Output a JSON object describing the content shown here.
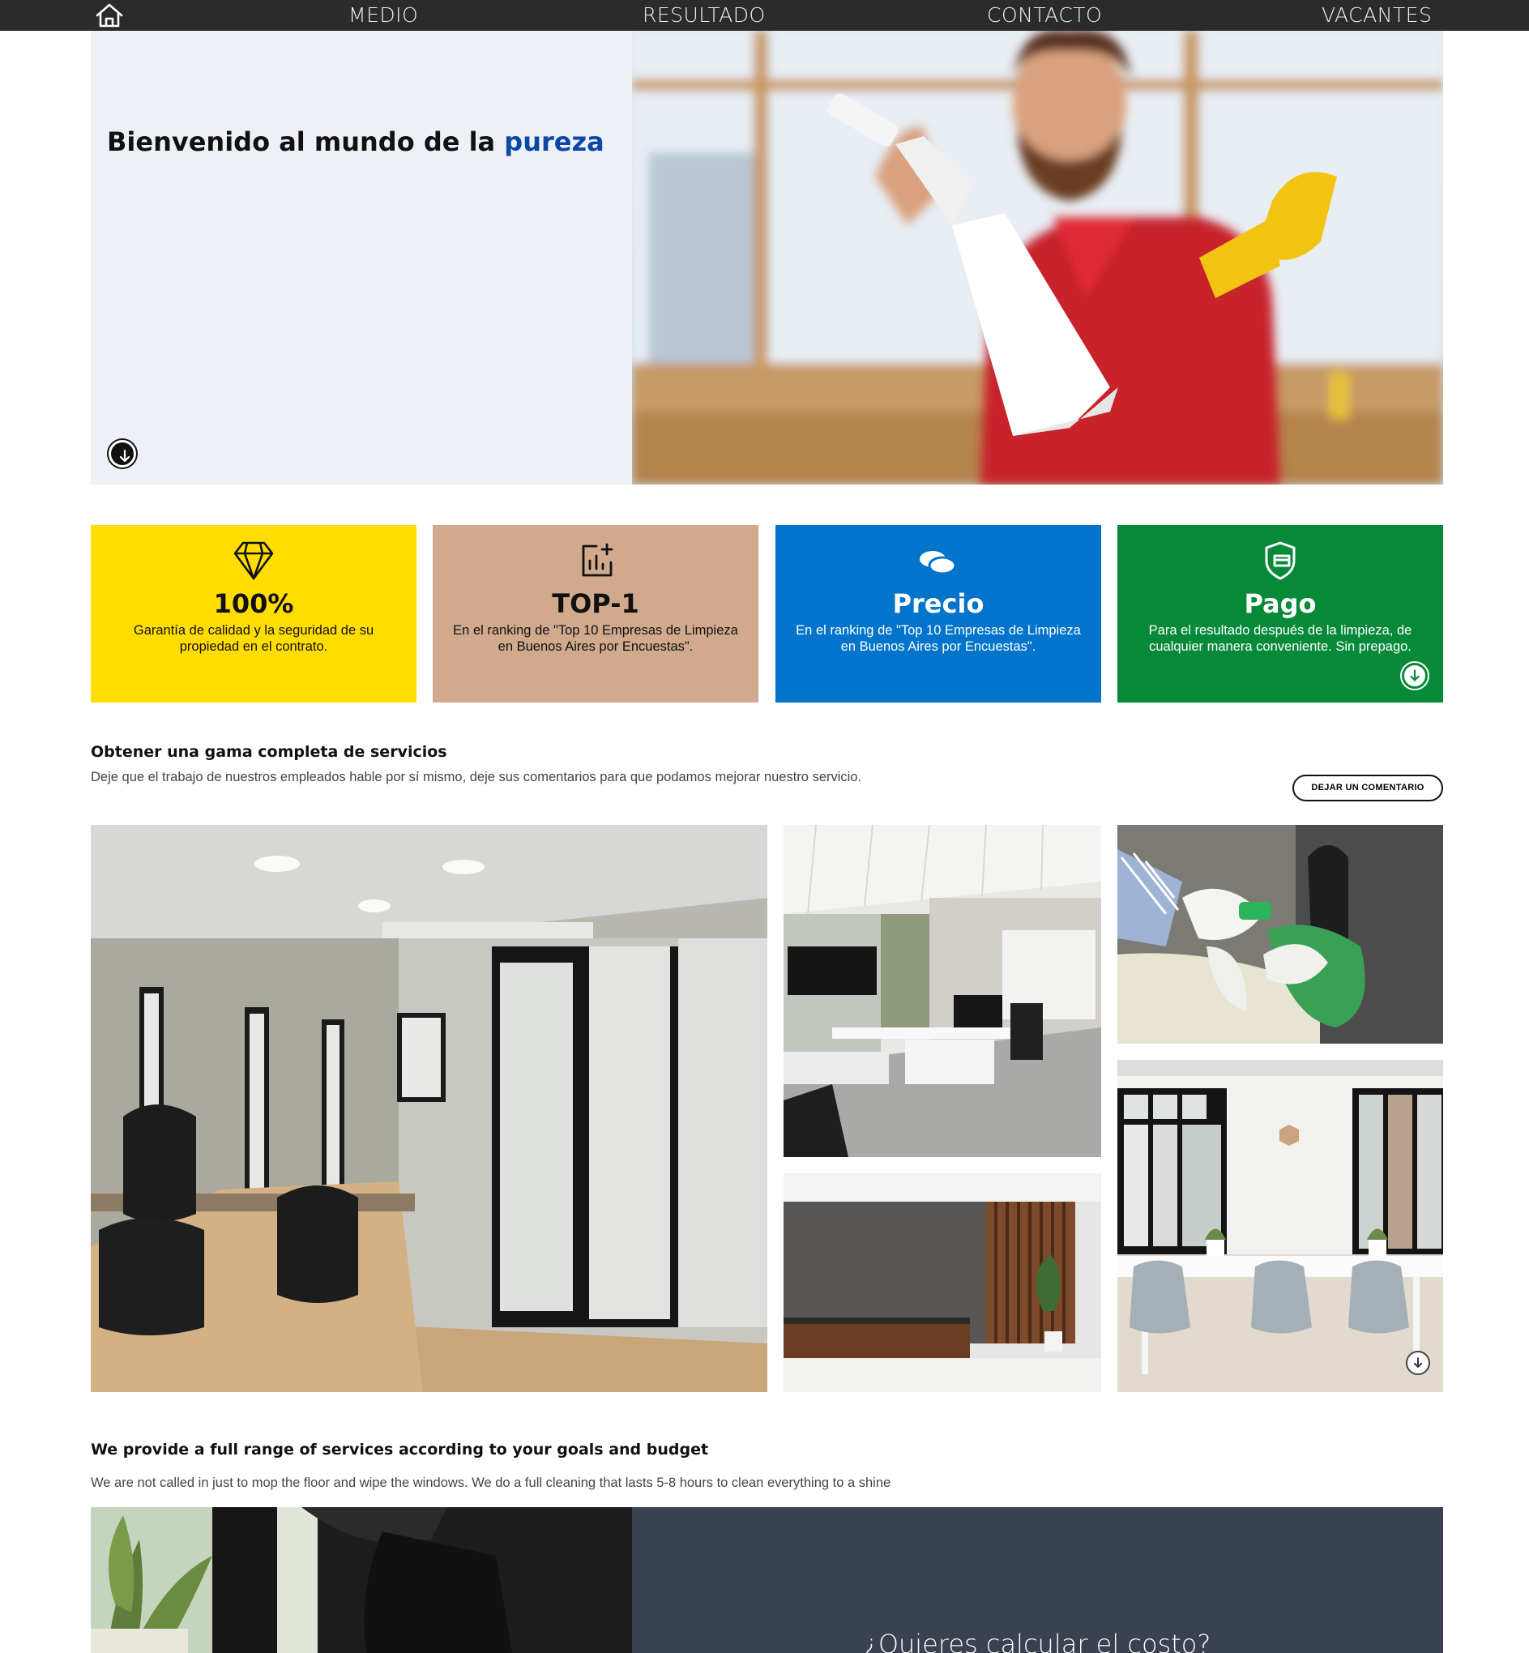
{
  "nav": {
    "home_icon": "home-icon",
    "links": [
      "MEDIO",
      "RESULTADO",
      "CONTACTO",
      "VACANTES"
    ]
  },
  "hero": {
    "title_start": "Bienvenido al mundo de la ",
    "title_accent": "pureza",
    "accent_color": "#0b47a6",
    "scroll_icon": "arrow-down-circle-icon"
  },
  "features": [
    {
      "icon": "diamond-icon",
      "title": "100%",
      "text": "Garantía de calidad y la seguridad de su propiedad en el contrato.",
      "bg": "#ffdd00",
      "fg": "#111111"
    },
    {
      "icon": "chart-plus-icon",
      "title": "TOP-1",
      "text": "En el ranking de \"Top 10 Empresas de Limpieza en Buenos Aires por Encuestas\".",
      "bg": "#d1a98c",
      "fg": "#111111"
    },
    {
      "icon": "coins-icon",
      "title": "Precio",
      "text": "En el ranking de \"Top 10 Empresas de Limpieza en Buenos Aires por Encuestas\".",
      "bg": "#0274cc",
      "fg": "#ffffff"
    },
    {
      "icon": "payment-shield-icon",
      "title": "Pago",
      "text": "Para el resultado después de la limpieza, de cualquier manera conveniente. Sin prepago.",
      "bg": "#068a39",
      "fg": "#ffffff"
    }
  ],
  "services": {
    "title": "Obtener una gama completa de servicios",
    "text": "Deje que el trabajo de nuestros empleados hable por sí mismo, deje sus comentarios para que podamos mejorar nuestro servicio.",
    "button": "DEJAR UN COMENTARIO"
  },
  "full_range": {
    "title": "We provide a full range of services according to your goals and budget",
    "text": "We are not called in just to mop the floor and wipe the windows. We do a full cleaning that lasts 5-8 hours to clean everything to a shine"
  },
  "cta": {
    "title": "¿Quieres calcular el costo?"
  }
}
